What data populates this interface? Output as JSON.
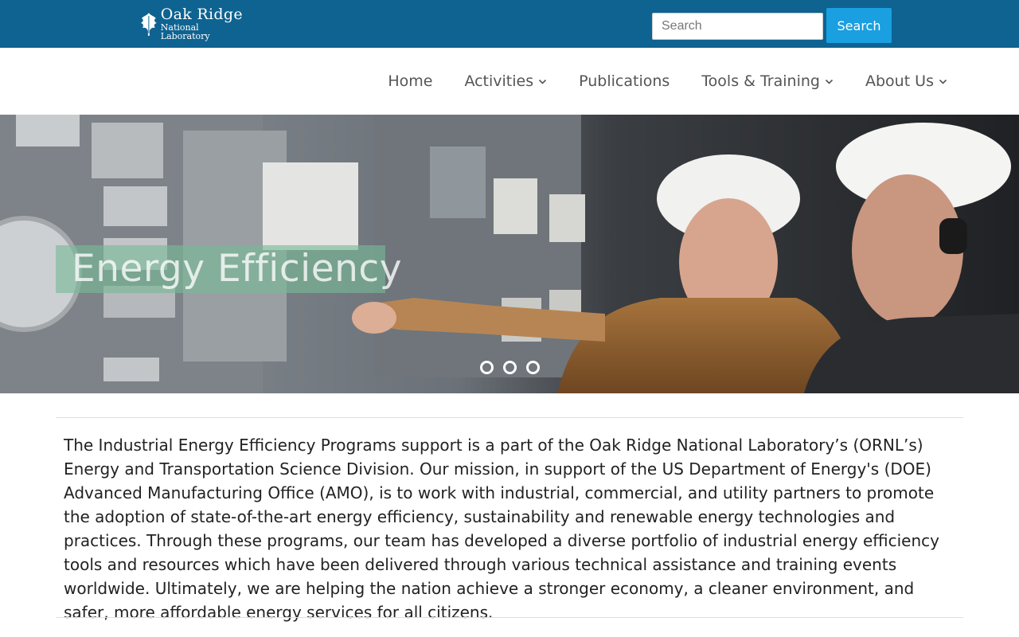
{
  "header": {
    "logo": {
      "line1": "Oak Ridge",
      "line2": "National Laboratory",
      "icon": "oak-leaf-icon"
    },
    "search": {
      "placeholder": "Search",
      "value": "",
      "button_label": "Search"
    }
  },
  "nav": {
    "items": [
      {
        "label": "Home",
        "has_dropdown": false
      },
      {
        "label": "Activities",
        "has_dropdown": true
      },
      {
        "label": "Publications",
        "has_dropdown": false
      },
      {
        "label": "Tools & Training",
        "has_dropdown": true
      },
      {
        "label": "About Us",
        "has_dropdown": true
      }
    ]
  },
  "hero": {
    "caption": "Energy Efficiency",
    "slide_count": 3
  },
  "intro": {
    "text": "The Industrial Energy Efficiency Programs support is a part of the Oak Ridge National Laboratory’s (ORNL’s) Energy and Transportation Science Division. Our mission, in support of the US Department of Energy's (DOE) Advanced Manufacturing Office (AMO), is to work with industrial, commercial, and utility partners to promote the adoption of state-of-the-art energy efficiency, sustainability and renewable energy technologies and practices. Through these programs, our team has developed a diverse portfolio of industrial energy efficiency tools and resources which have been delivered through various technical assistance and training events worldwide. Ultimately, we are helping the nation achieve a stronger economy, a cleaner environment, and safer, more affordable energy services for all citizens."
  },
  "colors": {
    "topbar": "#0e6391",
    "search_button": "#1a9fe0",
    "nav_text": "#555555",
    "caption_band": "#78b996"
  }
}
